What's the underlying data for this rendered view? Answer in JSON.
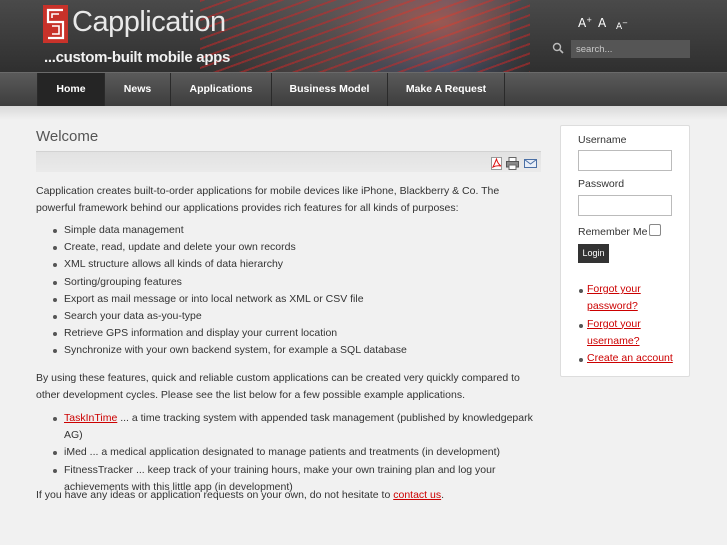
{
  "header": {
    "logo_name": "Capplication",
    "tagline": "...custom-built mobile apps",
    "font_size": {
      "large": "A",
      "large_sign": "+",
      "normal": "A",
      "small": "A",
      "small_sign": "−"
    },
    "search_placeholder": "search..."
  },
  "nav": {
    "items": [
      {
        "label": "Home",
        "active": true
      },
      {
        "label": "News"
      },
      {
        "label": "Applications"
      },
      {
        "label": "Business Model"
      },
      {
        "label": "Make A Request"
      }
    ]
  },
  "main": {
    "title": "Welcome",
    "toolbar_icons": [
      "pdf-icon",
      "print-icon",
      "email-icon"
    ],
    "intro": "Capplication creates built-to-order applications for mobile devices like iPhone, Blackberry & Co. The powerful framework behind our applications provides rich features for all kinds of purposes:",
    "features": [
      "Simple data management",
      "Create, read, update and delete your own records",
      "XML structure allows all kinds of data hierarchy",
      "Sorting/grouping features",
      "Export as mail message or into local network as XML or CSV file",
      "Search your data as-you-type",
      "Retrieve GPS information and display your current location",
      "Synchronize with your own backend system, for example a SQL database"
    ],
    "middle": "By using these features, quick and reliable custom applications can be created very quickly compared to other development cycles. Please see the list below for a few possible example applications.",
    "examples": [
      {
        "link": "TaskInTime",
        "text": " ... a time tracking system with appended task management (published by knowledgepark AG)"
      },
      {
        "link": "",
        "text": "iMed ... a medical application designated to manage patients and treatments (in development)"
      },
      {
        "link": "",
        "text": "FitnessTracker ... keep track of your training hours, make your own training plan and log your achievements with this little app (in development)"
      }
    ],
    "closing_prefix": "If you have any ideas or application requests on your own, do not hesitate to ",
    "closing_link": "contact us",
    "closing_suffix": "."
  },
  "login": {
    "username_label": "Username",
    "password_label": "Password",
    "remember_label": "Remember Me",
    "button_label": "Login",
    "links": [
      "Forgot your password?",
      "Forgot your username?",
      "Create an account"
    ]
  },
  "colors": {
    "link": "#cc0000",
    "nav_active": "#252525",
    "header": "#3a3a3a"
  }
}
